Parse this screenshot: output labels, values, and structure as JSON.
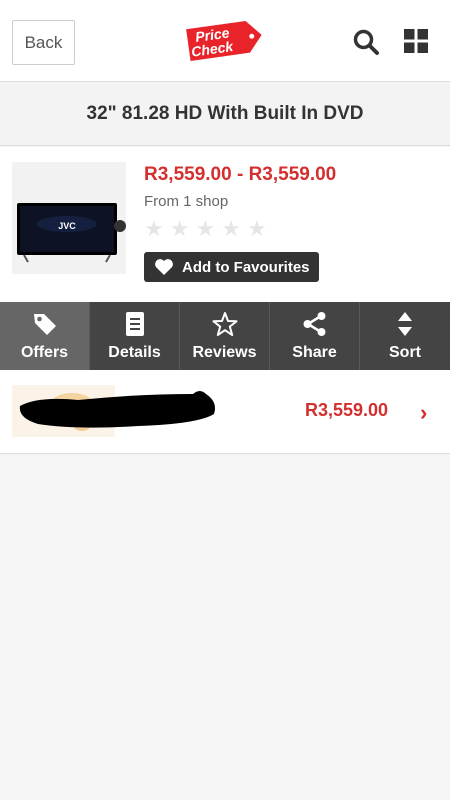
{
  "header": {
    "back_label": "Back",
    "logo_line1": "Price",
    "logo_line2": "Check",
    "brand_color": "#e8232a"
  },
  "page_title": "32\" 81.28 HD With Built In DVD",
  "product": {
    "thumb_brand": "JVC",
    "price_range": "R3,559.00 - R3,559.00",
    "shops": "From 1 shop",
    "rating_stars": 0,
    "rating_max": 5,
    "favourite_label": "Add to Favourites"
  },
  "tabs": [
    {
      "label": "Offers",
      "icon": "tag-icon",
      "active": true
    },
    {
      "label": "Details",
      "icon": "document-icon",
      "active": false
    },
    {
      "label": "Reviews",
      "icon": "star-icon",
      "active": false
    },
    {
      "label": "Share",
      "icon": "share-icon",
      "active": false
    },
    {
      "label": "Sort",
      "icon": "sort-icon",
      "active": false
    }
  ],
  "offers": [
    {
      "price": "R3,559.00"
    }
  ],
  "colors": {
    "accent": "#d32f2f",
    "tab_bar": "#444444",
    "tab_active": "#666666"
  }
}
